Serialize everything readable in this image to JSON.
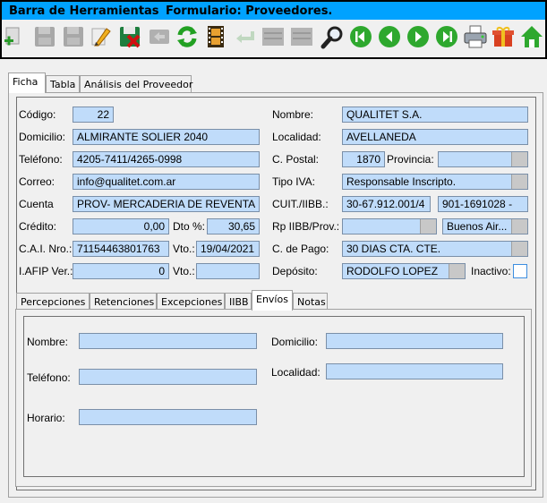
{
  "toolbar": {
    "title": "Barra de Herramientas",
    "form_title": "Formulario: Proveedores.",
    "buttons": [
      "add-icon",
      "save-disabled-icon",
      "save-as-disabled-icon",
      "edit-pencil-icon",
      "cancel-save-icon",
      "undo-disabled-icon",
      "refresh-icon",
      "film-icon",
      "return-icon",
      "disabled-icon",
      "disabled-icon",
      "search-icon",
      "first-record-icon",
      "previous-record-icon",
      "next-record-icon",
      "last-record-icon",
      "print-icon",
      "gift-icon",
      "home-icon"
    ]
  },
  "tabs": [
    "Ficha",
    "Tabla",
    "Análisis del Proveedor"
  ],
  "form": {
    "codigo_label": "Código:",
    "codigo": "22",
    "nombre_label": "Nombre:",
    "nombre": "QUALITET S.A.",
    "domicilio_label": "Domicilio:",
    "domicilio": "ALMIRANTE SOLIER 2040",
    "localidad_label": "Localidad:",
    "localidad": "AVELLANEDA",
    "telefono_label": "Teléfono:",
    "telefono": "4205-7411/4265-0998",
    "cpostal_label": "C. Postal:",
    "cpostal": "1870",
    "provincia_label": "Provincia:",
    "provincia": "",
    "correo_label": "Correo:",
    "correo": "info@qualitet.com.ar",
    "tipoiva_label": "Tipo IVA:",
    "tipoiva": "Responsable Inscripto.",
    "cuenta_label": "Cuenta",
    "cuenta": "PROV- MERCADERIA DE REVENTA",
    "cuit_label": "CUIT./IIBB.:",
    "cuit": "30-67.912.001/4",
    "iibb": "901-1691028 -",
    "credito_label": "Crédito:",
    "credito": "0,00",
    "dto_label": "Dto %:",
    "dto": "30,65",
    "rp_label": "Rp IIBB/Prov.:",
    "rp": "",
    "rp_prov": "Buenos Air...",
    "cai_label": "C.A.I. Nro.:",
    "cai": "71154463801763",
    "vto_label": "Vto.:",
    "vto": "19/04/2021",
    "cpago_label": "C. de Pago:",
    "cpago": "30 DIAS CTA. CTE.",
    "afip_label": "I.AFIP Ver.:",
    "afip": "0",
    "vto2_label": "Vto.:",
    "vto2": "",
    "deposito_label": "Depósito:",
    "deposito": "RODOLFO LOPEZ",
    "inactivo_label": "Inactivo:"
  },
  "subtabs": [
    "Percepciones",
    "Retenciones",
    "Excepciones",
    "IIBB",
    "Envíos",
    "Notas"
  ],
  "envios": {
    "nombre_label": "Nombre:",
    "nombre": "",
    "domicilio_label": "Domicilio:",
    "domicilio": "",
    "telefono_label": "Teléfono:",
    "telefono": "",
    "localidad_label": "Localidad:",
    "localidad": "",
    "horario_label": "Horario:",
    "horario": ""
  },
  "colors": {
    "title_bar": "#00a2ff",
    "field_bg": "#c0dcfa"
  }
}
